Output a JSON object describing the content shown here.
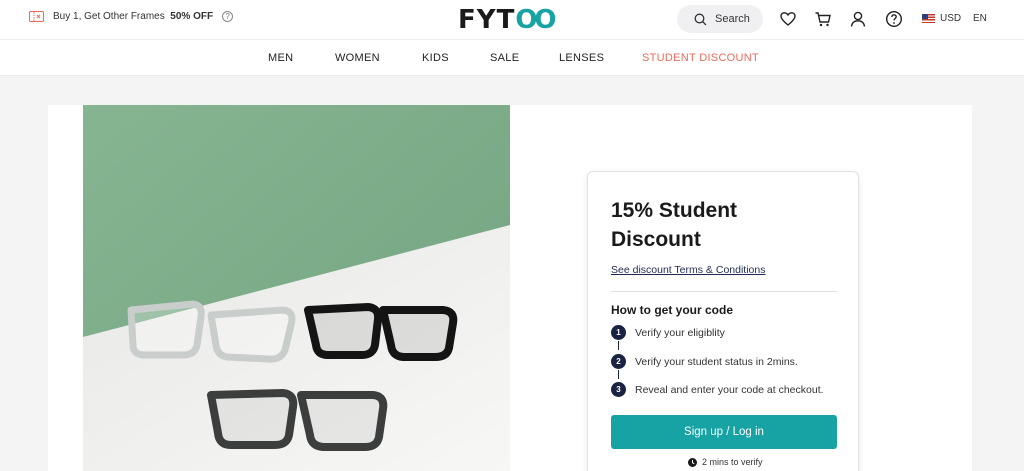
{
  "promo": {
    "text": "Buy 1, Get Other Frames",
    "highlight": "50% OFF",
    "help": "?"
  },
  "logo": {
    "prefix": "FYT",
    "suffix": "OO"
  },
  "header": {
    "search_label": "Search",
    "currency": "USD",
    "language": "EN"
  },
  "nav": {
    "items": [
      "MEN",
      "WOMEN",
      "KIDS",
      "SALE",
      "LENSES",
      "STUDENT DISCOUNT"
    ]
  },
  "card": {
    "title": "15% Student Discount",
    "terms_link": "See discount Terms & Conditions",
    "steps_heading": "How to get your code",
    "steps": [
      {
        "num": "1",
        "text": "Verify your eligiblity"
      },
      {
        "num": "2",
        "text": "Verify your student status in 2mins."
      },
      {
        "num": "3",
        "text": "Reveal and enter your code at checkout."
      }
    ],
    "button_label": "Sign up / Log in",
    "verify_note": "2 mins to verify"
  },
  "colors": {
    "accent": "#17a3a3",
    "highlight": "#ec6a5a",
    "hero_green": "#7fae8b",
    "step_dark": "#1a2342"
  }
}
